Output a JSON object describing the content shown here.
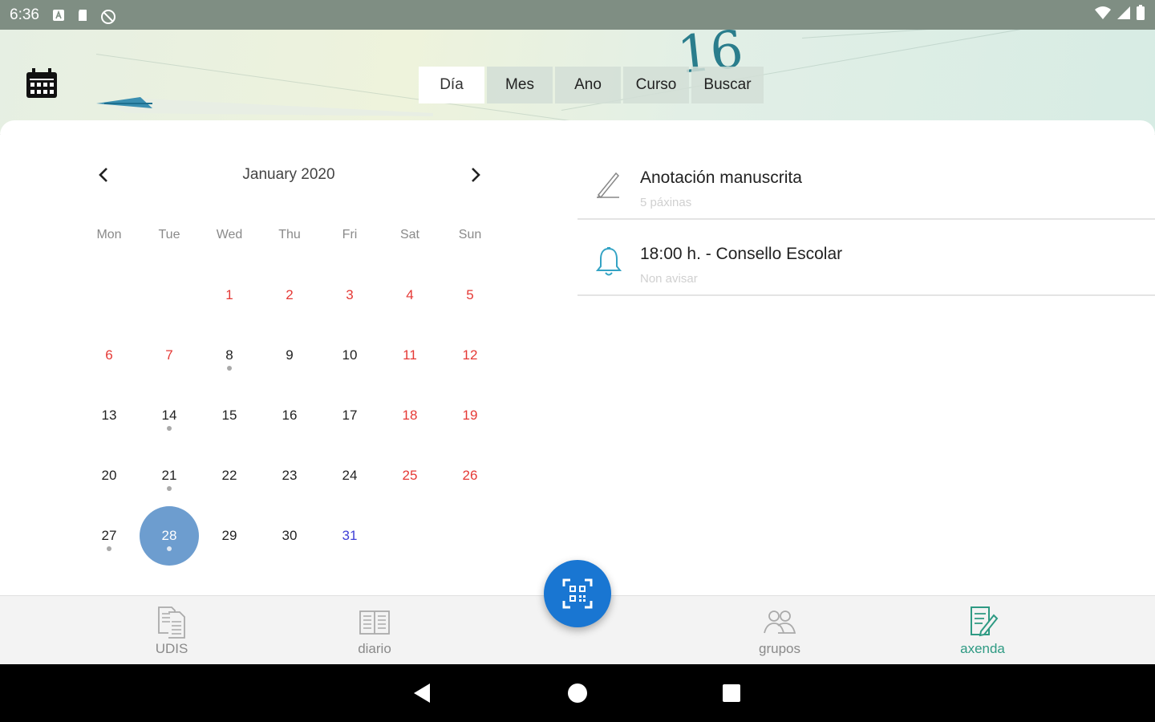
{
  "status_bar": {
    "time": "6:36"
  },
  "header": {
    "decor_number": "16",
    "tabs": [
      {
        "label": "Día",
        "active": true
      },
      {
        "label": "Mes",
        "active": false
      },
      {
        "label": "Ano",
        "active": false
      },
      {
        "label": "Curso",
        "active": false
      },
      {
        "label": "Buscar",
        "active": false
      }
    ]
  },
  "calendar": {
    "month_label": "January 2020",
    "weekdays": [
      "Mon",
      "Tue",
      "Wed",
      "Thu",
      "Fri",
      "Sat",
      "Sun"
    ],
    "selected_day": 28,
    "today": 31,
    "red_days": [
      1,
      2,
      3,
      4,
      5,
      6,
      7,
      11,
      12,
      18,
      19,
      25,
      26
    ],
    "dot_days": [
      8,
      14,
      21,
      27,
      28
    ],
    "weeks": [
      [
        "",
        "",
        "1",
        "2",
        "3",
        "4",
        "5"
      ],
      [
        "6",
        "7",
        "8",
        "9",
        "10",
        "11",
        "12"
      ],
      [
        "13",
        "14",
        "15",
        "16",
        "17",
        "18",
        "19"
      ],
      [
        "20",
        "21",
        "22",
        "23",
        "24",
        "25",
        "26"
      ],
      [
        "27",
        "28",
        "29",
        "30",
        "31",
        "",
        ""
      ]
    ]
  },
  "events": [
    {
      "icon": "pencil-icon",
      "title": "Anotación manuscrita",
      "subtitle": "5 páxinas"
    },
    {
      "icon": "bell-icon",
      "title": "18:00 h. - Consello Escolar",
      "subtitle": "Non avisar"
    }
  ],
  "bottom_nav": [
    {
      "label": "UDIS",
      "icon": "documents-icon",
      "active": false
    },
    {
      "label": "diario",
      "icon": "book-icon",
      "active": false
    },
    {
      "label": "grupos",
      "icon": "group-icon",
      "active": false
    },
    {
      "label": "axenda",
      "icon": "agenda-edit-icon",
      "active": true
    }
  ],
  "colors": {
    "accent_blue": "#1976d2",
    "selected_day": "#6d9dcf",
    "weekend_red": "#e53935",
    "active_nav": "#2e9a83",
    "today_blue": "#3f3fd6"
  }
}
